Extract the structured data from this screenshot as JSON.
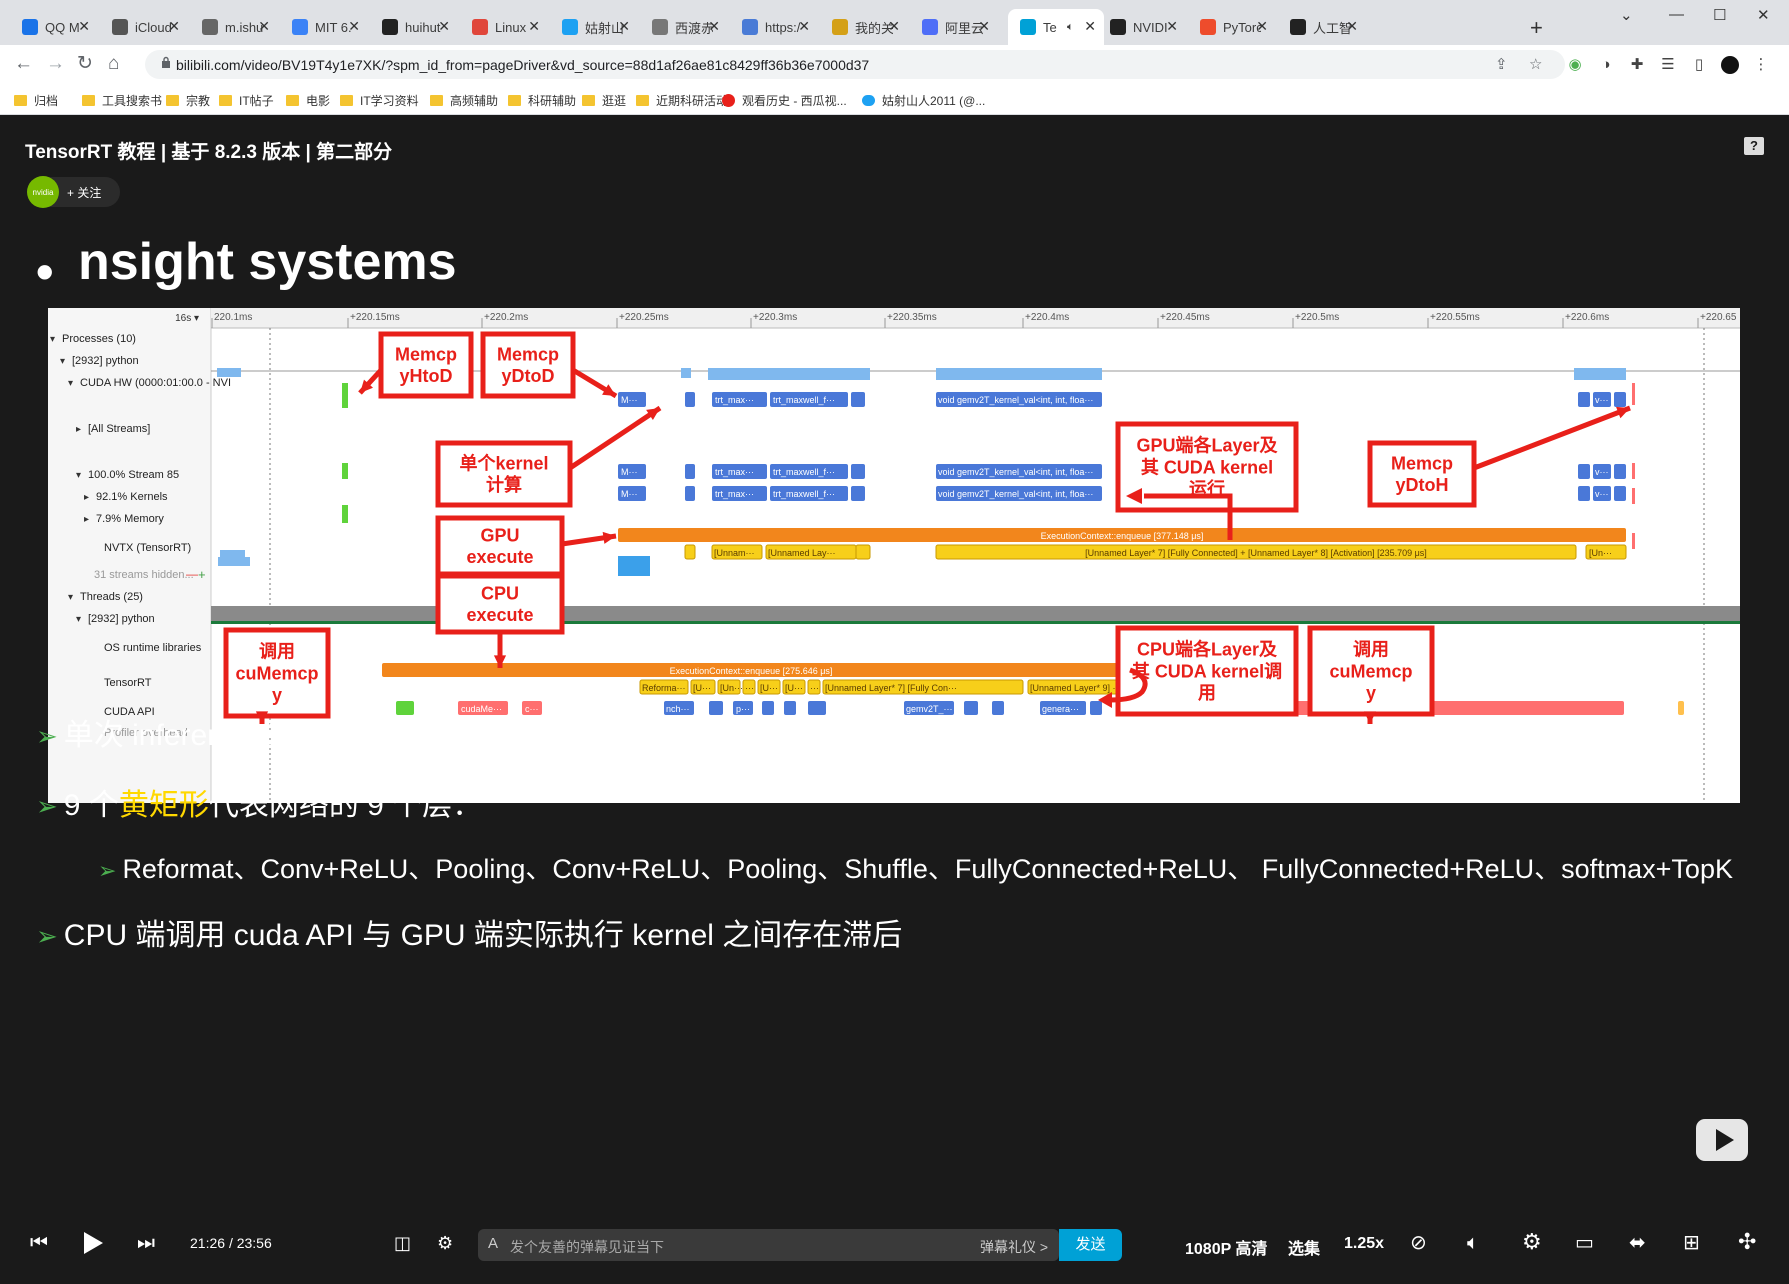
{
  "browser": {
    "tabs": [
      {
        "label": "QQ M",
        "icon": "qq-mail-icon",
        "color": "#1a73e8"
      },
      {
        "label": "iCloud",
        "icon": "apple-icon",
        "color": "#555555"
      },
      {
        "label": "m.ishu",
        "icon": "globe-icon",
        "color": "#666666"
      },
      {
        "label": "MIT 6.",
        "icon": "mit-icon",
        "color": "#3b82f6"
      },
      {
        "label": "huihut",
        "icon": "github-icon",
        "color": "#222222"
      },
      {
        "label": "Linux",
        "icon": "linux-icon",
        "color": "#e0463b"
      },
      {
        "label": "姑射山",
        "icon": "twitter-icon",
        "color": "#1da1f2"
      },
      {
        "label": "西渡赤",
        "icon": "wikipedia-icon",
        "color": "#777777"
      },
      {
        "label": "https:/",
        "icon": "link-icon",
        "color": "#4a7bd6"
      },
      {
        "label": "我的关",
        "icon": "tool-icon",
        "color": "#d4a017"
      },
      {
        "label": "阿里云",
        "icon": "aliyun-icon",
        "color": "#4f6ef7"
      },
      {
        "label": "Te",
        "icon": "bilibili-icon",
        "color": "#00a1d6"
      },
      {
        "label": "NVIDI",
        "icon": "github-icon",
        "color": "#222222"
      },
      {
        "label": "PyTorc",
        "icon": "pytorch-icon",
        "color": "#ee4c2c"
      },
      {
        "label": "人工智",
        "icon": "github-icon",
        "color": "#222222"
      }
    ],
    "url": "bilibili.com/video/BV19T4y1e7XK/?spm_id_from=pageDriver&vd_source=88d1af26ae81c8429ff36b36e7000d37",
    "bookmarks": [
      "归档",
      "工具搜索书",
      "宗教",
      "IT帖子",
      "电影",
      "IT学习资料",
      "高频辅助",
      "科研辅助",
      "逛逛",
      "近期科研活动",
      "观看历史 - 西瓜视...",
      "姑射山人2011 (@..."
    ]
  },
  "video": {
    "title": "TensorRT 教程 | 基于 8.2.3 版本 | 第二部分",
    "follow_label": "+ 关注",
    "avatar_text": "nvidia",
    "help_label": "?",
    "slide_heading": "nsight systems",
    "nsight": {
      "zoom_label": "16s ▾",
      "time_ticks": [
        "220.1ms",
        "+220.15ms",
        "+220.2ms",
        "+220.25ms",
        "+220.3ms",
        "+220.35ms",
        "+220.4ms",
        "+220.45ms",
        "+220.5ms",
        "+220.55ms",
        "+220.6ms",
        "+220.65"
      ],
      "rows": [
        {
          "label": "Processes (10)",
          "toggle": "▾"
        },
        {
          "label": "[2932] python",
          "toggle": "▾"
        },
        {
          "label": "CUDA HW (0000:01:00.0 - NVI",
          "toggle": "▾"
        },
        {
          "label": "[All Streams]",
          "toggle": "▸"
        },
        {
          "label": "100.0% Stream 85",
          "toggle": "▾"
        },
        {
          "label": "92.1% Kernels",
          "toggle": "▸"
        },
        {
          "label": "7.9% Memory",
          "toggle": "▸"
        },
        {
          "label": "NVTX (TensorRT)",
          "toggle": ""
        },
        {
          "label": "31 streams hidden...",
          "toggle": ""
        },
        {
          "label": "Threads (25)",
          "toggle": "▾"
        },
        {
          "label": "[2932] python",
          "toggle": "▾"
        },
        {
          "label": "OS runtime libraries",
          "toggle": ""
        },
        {
          "label": "TensorRT",
          "toggle": ""
        },
        {
          "label": "CUDA API",
          "toggle": ""
        },
        {
          "label": "Profiler overhead",
          "toggle": ""
        }
      ],
      "bar_labels": {
        "memcpy_m": "M···",
        "trt_max": "trt_max···",
        "trt_maxwell": "trt_maxwell_f···",
        "gemv": "void gemv2T_kernel_val<int, int, floa···",
        "v": "v···",
        "gpu_enqueue": "ExecutionContext::enqueue [377.148 μs]",
        "gpu_layer_a": "[Unnam···",
        "gpu_layer_b": "[Unnamed Lay···",
        "gpu_layer_c": "[Unnamed Layer* 7] [Fully Connected] + [Unnamed Layer* 8] [Activation] [235.709 μs]",
        "gpu_layer_d": "[Un···",
        "cpu_enqueue": "ExecutionContext::enqueue [275.646 μs]",
        "cpu_layers": [
          "Reforma···",
          "[U···",
          "[Un···",
          "···",
          "[U···",
          "[U···",
          "···",
          "[Unnamed Layer* 7] [Fully Con···",
          "[Unnamed Layer* 9] ···"
        ],
        "cuda_api": [
          "cudaMe···",
          "c···",
          "nch···",
          "p···",
          "gemv2T_···",
          "genera···"
        ]
      },
      "annotations": [
        {
          "id": "memcpy-htod",
          "text": "Memcp yHtoD"
        },
        {
          "id": "memcpy-dtod",
          "text": "Memcp yDtoD"
        },
        {
          "id": "single-kernel",
          "text": "单个kernel 计算"
        },
        {
          "id": "gpu-execute",
          "text": "GPU execute"
        },
        {
          "id": "cpu-execute",
          "text": "CPU execute"
        },
        {
          "id": "gpu-layer",
          "text": "GPU端各Layer及其 CUDA kernel运行"
        },
        {
          "id": "memcpy-dtoh",
          "text": "Memcp yDtoH"
        },
        {
          "id": "call-cumemcpy-left",
          "text": "调用 cuMemcp y"
        },
        {
          "id": "cpu-layer",
          "text": "CPU端各Layer及其 CUDA kernel调用"
        },
        {
          "id": "call-cumemcpy-right",
          "text": "调用 cuMemcp y"
        }
      ]
    },
    "bullets": [
      {
        "text": "单次 inference 的 timeline，展开 GPU部分"
      },
      {
        "pre": "9 个",
        "highlight": "黄矩形",
        "post": "代表网络的 9 个层："
      },
      {
        "text": "Reformat、Conv+ReLU、Pooling、Conv+ReLU、Pooling、Shuffle、FullyConnected+ReLU、 FullyConnected+ReLU、softmax+TopK"
      },
      {
        "text": "CPU 端调用 cuda API 与 GPU 端实际执行 kernel 之间存在滞后"
      }
    ]
  },
  "controls": {
    "current_time": "21:26",
    "separator": "/",
    "duration": "23:56",
    "danmu_placeholder": "发个友善的弹幕见证当下",
    "danmu_etiquette": "弹幕礼仪 >",
    "send_label": "发送",
    "quality": "1080P 高清",
    "episodes": "选集",
    "speed": "1.25x"
  },
  "colors": {
    "annotation_red": "#e8201a",
    "gpu_blue": "#4a78d8",
    "light_blue": "#7fb8ee",
    "orange": "#f2861c",
    "yellow": "#f7cf1a",
    "highlight_yellow": "#ffd800",
    "bilibili_blue": "#00a1d6"
  }
}
